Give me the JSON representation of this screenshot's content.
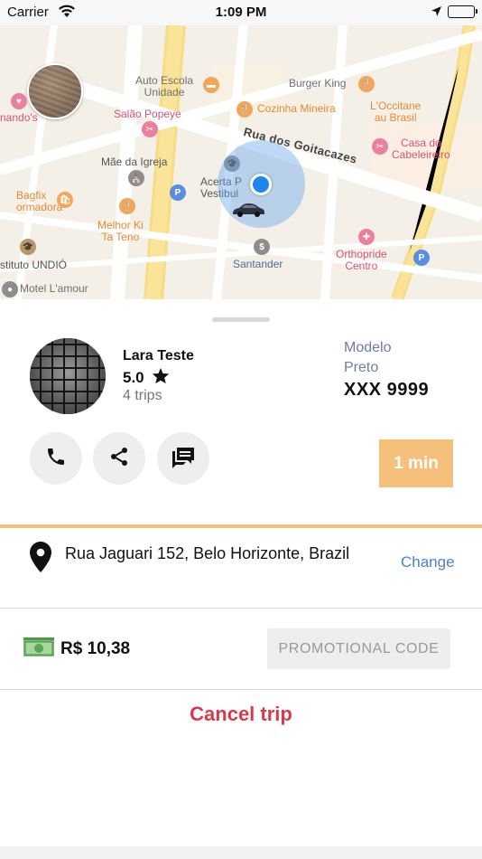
{
  "status_bar": {
    "carrier": "Carrier",
    "time": "1:09 PM"
  },
  "map": {
    "street_name": "Rua dos Goitacazes",
    "pois": {
      "nando": "nando's",
      "auto_escola": "Auto Escola\nUnidade",
      "burger_king": "Burger King",
      "salao": "Salão Popeye",
      "cozinha": "Cozinha Mineira",
      "loccitane": "L'Occitane\nau Brasil",
      "mae_igreja": "Mãe da Igreja",
      "casa_cabeleireiro": "Casa do\nCabeleireiro",
      "acerta": "Acerta P\nVestibul",
      "bagfix": "Bagfix\normadora",
      "melhor_ki": "Melhor Ki\nTa Teno",
      "instituto": "stituto UNDIÓ",
      "santander": "Santander",
      "orthopride": "Orthopride\nCentro",
      "motel": "Motel L'amour"
    }
  },
  "driver": {
    "name": "Lara Teste",
    "rating": "5.0",
    "trips": "4 trips"
  },
  "vehicle": {
    "model": "Modelo",
    "color": "Preto",
    "plate": "XXX 9999"
  },
  "eta": "1 min",
  "destination": {
    "address": "Rua Jaguari 152, Belo Horizonte, Brazil",
    "change_label": "Change"
  },
  "payment": {
    "price": "R$ 10,38",
    "promo_label": "PROMOTIONAL CODE"
  },
  "cancel_label": "Cancel trip",
  "colors": {
    "accent": "#f4c07b",
    "link": "#4e7fd2",
    "danger": "#d83a48",
    "location": "#1f86f1"
  }
}
